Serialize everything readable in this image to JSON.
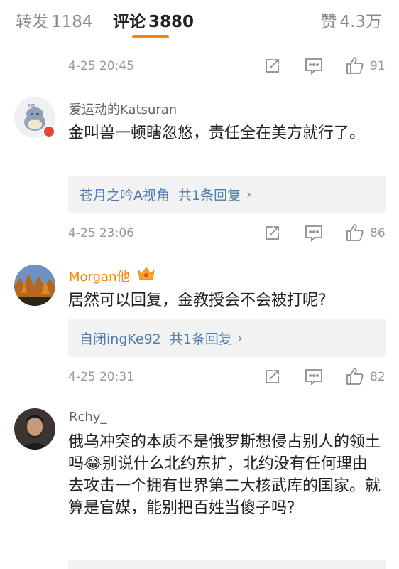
{
  "tabs": {
    "repost_label": "转发",
    "repost_count": "1184",
    "comments_label": "评论",
    "comments_count": "3880",
    "likes_label": "赞",
    "likes_count": "4.3万"
  },
  "colors": {
    "accent_orange": "#ff8200",
    "link_blue": "#507daf",
    "meta_gray": "#999999",
    "reply_bg": "#f2f2f2"
  },
  "icons": [
    "repost-icon",
    "comment-icon",
    "thumbs-up-icon",
    "chevron-right-icon",
    "crown-icon",
    "vip-badge-icon"
  ],
  "top_action_row": {
    "time": "4-25 20:45",
    "likes": "91"
  },
  "comments": [
    {
      "username": "爱运动的Katsuran",
      "text": "金叫兽一顿瞎忽悠，责任全在美方就行了。",
      "reply_link": "苍月之吟A视角",
      "reply_count": "共1条回复",
      "time": "4-25 23:06",
      "likes": "86"
    },
    {
      "username": "Morgan他",
      "text": "居然可以回复，金教授会不会被打呢?",
      "reply_link": "自闭ingKe92",
      "reply_count": "共1条回复",
      "time": "4-25 20:31",
      "likes": "82"
    },
    {
      "username": "Rchy_",
      "text_part1": "俄乌冲突的本质不是俄罗斯想侵占别人的领土吗",
      "emoji": "😂",
      "text_part2": "别说什么北约东扩，北约没有任何理由去攻击一个拥有世界第二大核武库的国家。就算是官媒，能别把百姓当傻子吗?"
    }
  ]
}
